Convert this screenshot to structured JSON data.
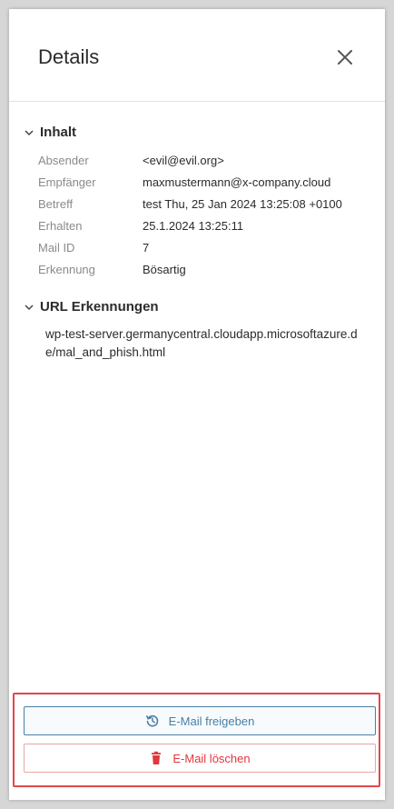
{
  "header": {
    "title": "Details"
  },
  "sections": {
    "content": {
      "title": "Inhalt",
      "rows": [
        {
          "label": "Absender",
          "value": "<evil@evil.org>"
        },
        {
          "label": "Empfänger",
          "value": "maxmustermann@x-company.cloud"
        },
        {
          "label": "Betreff",
          "value": "test Thu, 25 Jan 2024 13:25:08 +0100"
        },
        {
          "label": "Erhalten",
          "value": "25.1.2024 13:25:11"
        },
        {
          "label": "Mail ID",
          "value": "7"
        },
        {
          "label": "Erkennung",
          "value": "Bösartig"
        }
      ]
    },
    "url_detections": {
      "title": "URL Erkennungen",
      "url": "wp-test-server.germanycentral.cloudapp.microsoftazure.de/mal_and_phish.html"
    }
  },
  "actions": {
    "release_label": "E-Mail freigeben",
    "delete_label": "E-Mail löschen"
  },
  "colors": {
    "release_accent": "#4a7fa5",
    "delete_accent": "#e0373d",
    "highlight_border": "#e0474c"
  },
  "icons": {
    "close": "close-icon",
    "chevron": "chevron-down-icon",
    "release": "restore-icon",
    "delete": "trash-icon"
  }
}
